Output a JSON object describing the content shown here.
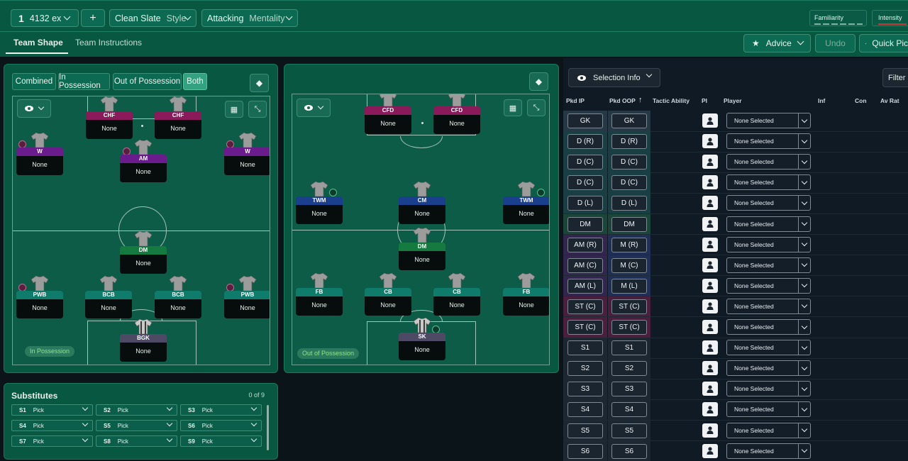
{
  "topbar": {
    "tactic_num": "1",
    "tactic_name": "4132 ex",
    "add_label": "+",
    "style_value": "Clean Slate",
    "style_label": "Style",
    "mentality_value": "Attacking",
    "mentality_label": "Mentality",
    "familiarity_label": "Familiarity",
    "intensity_label": "Intensity"
  },
  "tabs": {
    "team_shape": "Team Shape",
    "team_instructions": "Team Instructions"
  },
  "actions": {
    "advice": "Advice",
    "undo": "Undo",
    "quick_pick": "Quick Pic"
  },
  "view_modes": {
    "combined": "Combined",
    "in_possession": "In Possession",
    "out_of_possession": "Out of Possession",
    "both": "Both"
  },
  "pitch_ip": {
    "tag": "In Possession",
    "players": [
      {
        "pos": "CHF",
        "name": "None",
        "color": "#8a1a5a"
      },
      {
        "pos": "CHF",
        "name": "None",
        "color": "#8a1a5a"
      },
      {
        "pos": "W",
        "name": "None",
        "color": "#6a1b8c"
      },
      {
        "pos": "AM",
        "name": "None",
        "color": "#6a1b8c"
      },
      {
        "pos": "W",
        "name": "None",
        "color": "#6a1b8c"
      },
      {
        "pos": "DM",
        "name": "None",
        "color": "#157a3f"
      },
      {
        "pos": "PWB",
        "name": "None",
        "color": "#0f7b6a"
      },
      {
        "pos": "BCB",
        "name": "None",
        "color": "#0f7b6a"
      },
      {
        "pos": "BCB",
        "name": "None",
        "color": "#0f7b6a"
      },
      {
        "pos": "PWB",
        "name": "None",
        "color": "#0f7b6a"
      },
      {
        "pos": "BGK",
        "name": "None",
        "color": "#4e4a66"
      }
    ]
  },
  "pitch_oop": {
    "tag": "Out of Possession",
    "players": [
      {
        "pos": "CFD",
        "name": "None",
        "color": "#8a1a5a"
      },
      {
        "pos": "CFD",
        "name": "None",
        "color": "#8a1a5a"
      },
      {
        "pos": "TWM",
        "name": "None",
        "color": "#1a3f8c"
      },
      {
        "pos": "CM",
        "name": "None",
        "color": "#1a3f8c"
      },
      {
        "pos": "TWM",
        "name": "None",
        "color": "#1a3f8c"
      },
      {
        "pos": "DM",
        "name": "None",
        "color": "#157a3f"
      },
      {
        "pos": "FB",
        "name": "None",
        "color": "#0f7b6a"
      },
      {
        "pos": "CB",
        "name": "None",
        "color": "#0f7b6a"
      },
      {
        "pos": "CB",
        "name": "None",
        "color": "#0f7b6a"
      },
      {
        "pos": "FB",
        "name": "None",
        "color": "#0f7b6a"
      },
      {
        "pos": "SK",
        "name": "None",
        "color": "#4e4a66"
      }
    ]
  },
  "substitutes": {
    "title": "Substitutes",
    "count": "0 of 9",
    "slots": [
      {
        "label": "S1",
        "value": "Pick"
      },
      {
        "label": "S2",
        "value": "Pick"
      },
      {
        "label": "S3",
        "value": "Pick"
      },
      {
        "label": "S4",
        "value": "Pick"
      },
      {
        "label": "S5",
        "value": "Pick"
      },
      {
        "label": "S6",
        "value": "Pick"
      },
      {
        "label": "S7",
        "value": "Pick"
      },
      {
        "label": "S8",
        "value": "Pick"
      },
      {
        "label": "S9",
        "value": "Pick"
      }
    ]
  },
  "selection": {
    "info_label": "Selection Info",
    "filter_label": "Filter",
    "headers": {
      "pkd_ip": "Pkd IP",
      "pkd_oop": "Pkd OOP",
      "tactic_ability": "Tactic Ability",
      "pi": "PI",
      "player": "Player",
      "inf": "Inf",
      "con": "Con",
      "av_rat": "Av Rat"
    },
    "rows": [
      {
        "ip": "GK",
        "oop": "GK",
        "player": "None Selected",
        "bg": "#253845"
      },
      {
        "ip": "D (R)",
        "oop": "D (R)",
        "player": "None Selected",
        "bg": "#193f45"
      },
      {
        "ip": "D (C)",
        "oop": "D (C)",
        "player": "None Selected",
        "bg": "#193f45"
      },
      {
        "ip": "D (C)",
        "oop": "D (C)",
        "player": "None Selected",
        "bg": "#193f45"
      },
      {
        "ip": "D (L)",
        "oop": "D (L)",
        "player": "None Selected",
        "bg": "#193f45"
      },
      {
        "ip": "DM",
        "oop": "DM",
        "player": "None Selected",
        "bg": "#1a4638"
      },
      {
        "ip": "AM (R)",
        "oop": "M (R)",
        "player": "None Selected",
        "bg": "#33264e",
        "bg2": "#1f2f55"
      },
      {
        "ip": "AM (C)",
        "oop": "M (C)",
        "player": "None Selected",
        "bg": "#33264e",
        "bg2": "#1f2f55"
      },
      {
        "ip": "AM (L)",
        "oop": "M (L)",
        "player": "None Selected",
        "bg": "#33264e",
        "bg2": "#1f2f55"
      },
      {
        "ip": "ST (C)",
        "oop": "ST (C)",
        "player": "None Selected",
        "bg": "#4a1f3d"
      },
      {
        "ip": "ST (C)",
        "oop": "ST (C)",
        "player": "None Selected",
        "bg": "#4a1f3d"
      },
      {
        "ip": "S1",
        "oop": "S1",
        "player": "None Selected",
        "bg": "#1d2731"
      },
      {
        "ip": "S2",
        "oop": "S2",
        "player": "None Selected",
        "bg": "#1d2731"
      },
      {
        "ip": "S3",
        "oop": "S3",
        "player": "None Selected",
        "bg": "#1d2731"
      },
      {
        "ip": "S4",
        "oop": "S4",
        "player": "None Selected",
        "bg": "#1d2731"
      },
      {
        "ip": "S5",
        "oop": "S5",
        "player": "None Selected",
        "bg": "#1d2731"
      },
      {
        "ip": "S6",
        "oop": "S6",
        "player": "None Selected",
        "bg": "#1d2731"
      }
    ]
  }
}
